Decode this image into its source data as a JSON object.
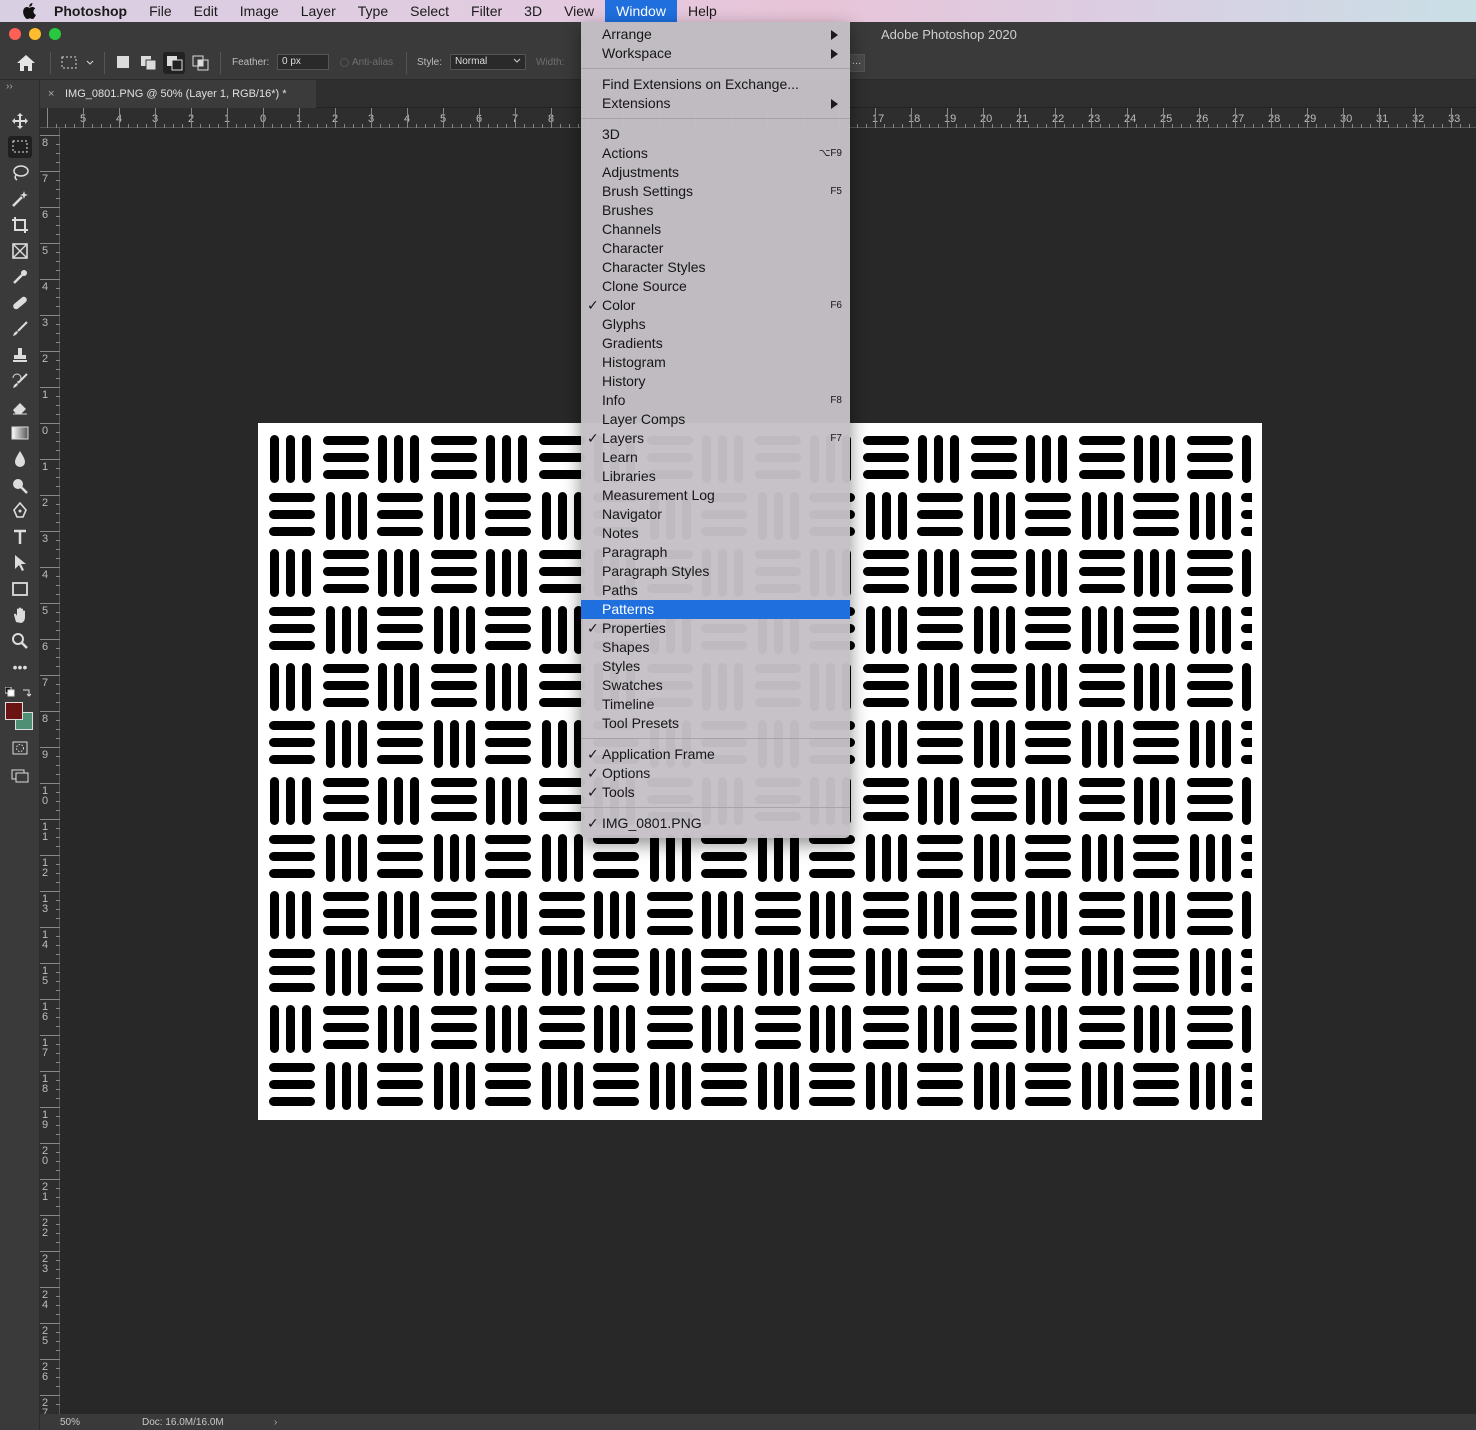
{
  "menubar": {
    "app": "Photoshop",
    "items": [
      "File",
      "Edit",
      "Image",
      "Layer",
      "Type",
      "Select",
      "Filter",
      "3D",
      "View",
      "Window",
      "Help"
    ],
    "active": "Window"
  },
  "window_title": "Adobe Photoshop 2020",
  "options": {
    "feather_label": "Feather:",
    "feather_value": "0 px",
    "antialias_label": "Anti-alias",
    "style_label": "Style:",
    "style_value": "Normal",
    "width_label": "Width:"
  },
  "document_tab": "IMG_0801.PNG @ 50% (Layer 1, RGB/16*) *",
  "status": {
    "zoom": "50%",
    "doc": "Doc: 16.0M/16.0M"
  },
  "ruler_h": [
    "5",
    "4",
    "3",
    "2",
    "1",
    "0",
    "1",
    "2",
    "3",
    "4",
    "5",
    "6",
    "7",
    "8",
    "17",
    "18",
    "19",
    "20",
    "21",
    "22",
    "23",
    "24",
    "25",
    "26",
    "27",
    "28",
    "29",
    "30",
    "31",
    "32",
    "33"
  ],
  "ruler_v": [
    "8",
    "7",
    "6",
    "5",
    "4",
    "3",
    "2",
    "1",
    "0",
    "1",
    "2",
    "3",
    "4",
    "5",
    "6",
    "7",
    "8",
    "9",
    "10",
    "11",
    "12",
    "13",
    "14",
    "15",
    "16",
    "17",
    "18",
    "19",
    "20",
    "21",
    "22",
    "23",
    "24",
    "25",
    "26",
    "27"
  ],
  "colors": {
    "foreground": "#6b1414",
    "background": "#4f8f74",
    "highlight": "#1f6fde"
  },
  "window_menu": [
    {
      "label": "Arrange",
      "submenu": true
    },
    {
      "label": "Workspace",
      "submenu": true
    },
    {
      "sep": true
    },
    {
      "label": "Find Extensions on Exchange..."
    },
    {
      "label": "Extensions",
      "submenu": true
    },
    {
      "sep": true
    },
    {
      "label": "3D"
    },
    {
      "label": "Actions",
      "shortcut": "⌥F9"
    },
    {
      "label": "Adjustments"
    },
    {
      "label": "Brush Settings",
      "shortcut": "F5"
    },
    {
      "label": "Brushes"
    },
    {
      "label": "Channels"
    },
    {
      "label": "Character"
    },
    {
      "label": "Character Styles"
    },
    {
      "label": "Clone Source"
    },
    {
      "label": "Color",
      "checked": true,
      "shortcut": "F6"
    },
    {
      "label": "Glyphs"
    },
    {
      "label": "Gradients"
    },
    {
      "label": "Histogram"
    },
    {
      "label": "History"
    },
    {
      "label": "Info",
      "shortcut": "F8"
    },
    {
      "label": "Layer Comps"
    },
    {
      "label": "Layers",
      "checked": true,
      "shortcut": "F7"
    },
    {
      "label": "Learn"
    },
    {
      "label": "Libraries"
    },
    {
      "label": "Measurement Log"
    },
    {
      "label": "Navigator"
    },
    {
      "label": "Notes"
    },
    {
      "label": "Paragraph"
    },
    {
      "label": "Paragraph Styles"
    },
    {
      "label": "Paths"
    },
    {
      "label": "Patterns",
      "highlighted": true
    },
    {
      "label": "Properties",
      "checked": true
    },
    {
      "label": "Shapes"
    },
    {
      "label": "Styles"
    },
    {
      "label": "Swatches"
    },
    {
      "label": "Timeline"
    },
    {
      "label": "Tool Presets"
    },
    {
      "sep": true
    },
    {
      "label": "Application Frame",
      "checked": true
    },
    {
      "label": "Options",
      "checked": true
    },
    {
      "label": "Tools",
      "checked": true
    },
    {
      "sep": true
    },
    {
      "label": "IMG_0801.PNG",
      "checked": true
    }
  ]
}
